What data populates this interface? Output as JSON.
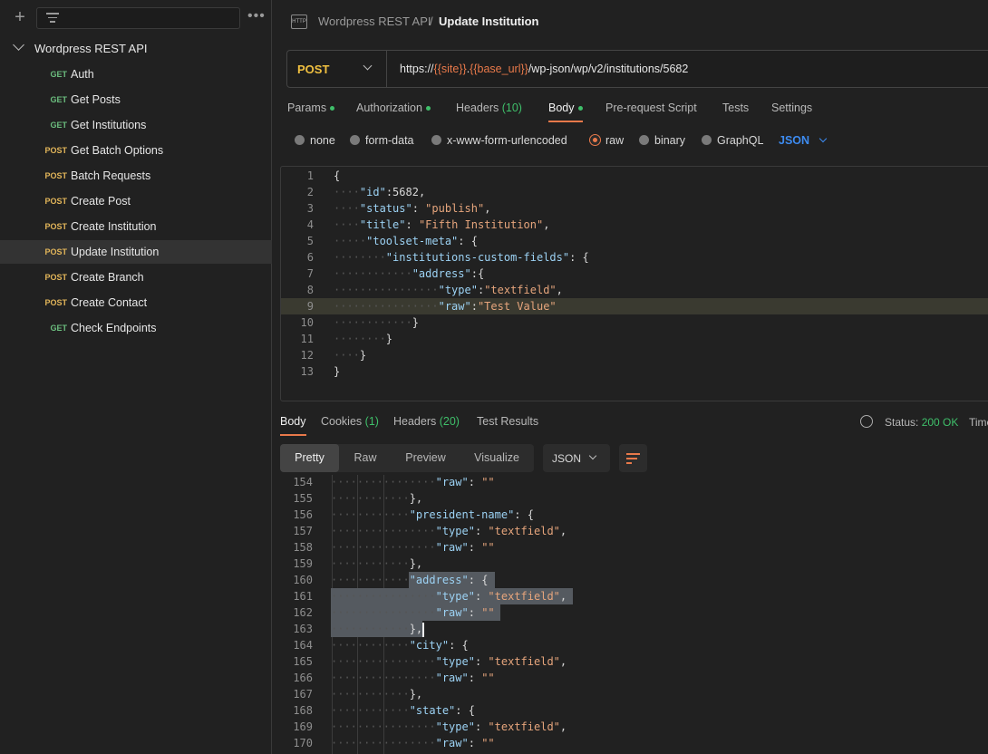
{
  "sidebar": {
    "collection_name": "Wordpress REST API",
    "requests": [
      {
        "method": "GET",
        "name": "Auth"
      },
      {
        "method": "GET",
        "name": "Get Posts"
      },
      {
        "method": "GET",
        "name": "Get Institutions"
      },
      {
        "method": "POST",
        "name": "Get Batch Options"
      },
      {
        "method": "POST",
        "name": "Batch Requests"
      },
      {
        "method": "POST",
        "name": "Create Post"
      },
      {
        "method": "POST",
        "name": "Create Institution"
      },
      {
        "method": "POST",
        "name": "Update Institution"
      },
      {
        "method": "POST",
        "name": "Create Branch"
      },
      {
        "method": "POST",
        "name": "Create Contact"
      },
      {
        "method": "GET",
        "name": "Check Endpoints"
      }
    ],
    "active_index": 7
  },
  "breadcrumb": {
    "icon_label": "HTTP",
    "collection": "Wordpress REST API",
    "separator": "/",
    "request": "Update Institution"
  },
  "request": {
    "method": "POST",
    "url_prefix": "https://",
    "var_site": "{{site}}",
    "dot": ".",
    "var_base_url": "{{base_url}}",
    "url_suffix": "/wp-json/wp/v2/institutions/5682"
  },
  "request_tabs": {
    "params": "Params",
    "authorization": "Authorization",
    "headers": "Headers",
    "headers_count": "(10)",
    "body": "Body",
    "pre_request": "Pre-request Script",
    "tests": "Tests",
    "settings": "Settings"
  },
  "body_options": {
    "none": "none",
    "form_data": "form-data",
    "urlencoded": "x-www-form-urlencoded",
    "raw": "raw",
    "binary": "binary",
    "graphql": "GraphQL",
    "format": "JSON"
  },
  "request_body_lines": [
    "{",
    "    \"id\":5682,",
    "    \"status\": \"publish\",",
    "    \"title\": \"Fifth Institution\",",
    "     \"toolset-meta\": {",
    "        \"institutions-custom-fields\": {",
    "            \"address\":{",
    "                \"type\":\"textfield\",",
    "                \"raw\":\"Test Value\"",
    "            }",
    "        }",
    "    }",
    "}"
  ],
  "response_tabs": {
    "body": "Body",
    "cookies": "Cookies",
    "cookies_count": "(1)",
    "headers": "Headers",
    "headers_count": "(20)",
    "test_results": "Test Results"
  },
  "response_status": {
    "status_label": "Status:",
    "status_value": "200 OK",
    "time_label": "Time"
  },
  "response_toolbar": {
    "pretty": "Pretty",
    "raw": "Raw",
    "preview": "Preview",
    "visualize": "Visualize",
    "format": "JSON"
  },
  "response_lines": [
    {
      "n": "154",
      "code": "                \"raw\": \"\""
    },
    {
      "n": "155",
      "code": "            },"
    },
    {
      "n": "156",
      "code": "            \"president-name\": {"
    },
    {
      "n": "157",
      "code": "                \"type\": \"textfield\","
    },
    {
      "n": "158",
      "code": "                \"raw\": \"\""
    },
    {
      "n": "159",
      "code": "            },"
    },
    {
      "n": "160",
      "code": "            \"address\": {"
    },
    {
      "n": "161",
      "code": "                \"type\": \"textfield\","
    },
    {
      "n": "162",
      "code": "                \"raw\": \"\""
    },
    {
      "n": "163",
      "code": "            },"
    },
    {
      "n": "164",
      "code": "            \"city\": {"
    },
    {
      "n": "165",
      "code": "                \"type\": \"textfield\","
    },
    {
      "n": "166",
      "code": "                \"raw\": \"\""
    },
    {
      "n": "167",
      "code": "            },"
    },
    {
      "n": "168",
      "code": "            \"state\": {"
    },
    {
      "n": "169",
      "code": "                \"type\": \"textfield\","
    },
    {
      "n": "170",
      "code": "                \"raw\": \"\""
    }
  ]
}
